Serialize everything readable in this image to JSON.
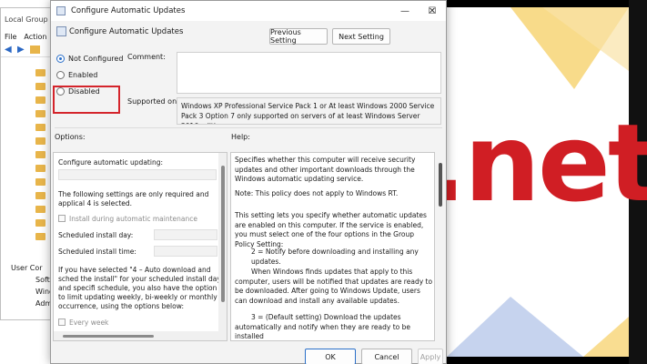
{
  "background": {
    "brand_text": ".net",
    "colors": {
      "red": "#d01e24",
      "yellow": "#f7d576",
      "blue": "#b8c8ea"
    }
  },
  "mmc": {
    "title": "Local Group",
    "menu": [
      "File",
      "Action"
    ],
    "tree_labels": [
      "User Cor",
      "Softv",
      "Wind",
      "Admi"
    ]
  },
  "dialog": {
    "title": "Configure Automatic Updates",
    "header_title": "Configure Automatic Updates",
    "prev_button": "Previous Setting",
    "next_button": "Next Setting",
    "radios": {
      "not_configured": "Not Configured",
      "enabled": "Enabled",
      "disabled": "Disabled",
      "selected": "not_configured"
    },
    "comment_label": "Comment:",
    "supported_label": "Supported on:",
    "supported_text": "Windows XP Professional Service Pack 1 or At least Windows 2000 Service Pack 3 Option 7 only supported on servers of at least Windows Server 2016 edition",
    "options_label": "Options:",
    "help_label": "Help:",
    "options": {
      "configure_label": "Configure automatic updating:",
      "settings_note": "The following settings are only required and applical 4 is selected.",
      "install_maintenance": "Install during automatic maintenance",
      "scheduled_day": "Scheduled install day:",
      "scheduled_time": "Scheduled install time:",
      "auto_note": "If you have selected \"4 – Auto download and sched the install\" for your scheduled install day and specifi schedule, you also have the option to limit updating weekly, bi-weekly or monthly occurrence, using the options below:",
      "every_week": "Every week"
    },
    "help": [
      "Specifies whether this computer will receive security updates and other important downloads through the Windows automatic updating service.",
      "Note: This policy does not apply to Windows RT.",
      "This setting lets you specify whether automatic updates are enabled on this computer. If the service is enabled, you must select one of the four options in the Group Policy Setting:",
      "2 = Notify before downloading and installing any updates.",
      "When Windows finds updates that apply to this computer, users will be notified that updates are ready to be downloaded. After going to Windows Update, users can download and install any available updates.",
      "3 = (Default setting) Download the updates automatically and notify when they are ready to be installed"
    ],
    "ok_button": "OK",
    "cancel_button": "Cancel",
    "apply_button": "Apply",
    "window_controls": {
      "minimize": "—",
      "maximize": "☐",
      "close": "✕"
    }
  }
}
